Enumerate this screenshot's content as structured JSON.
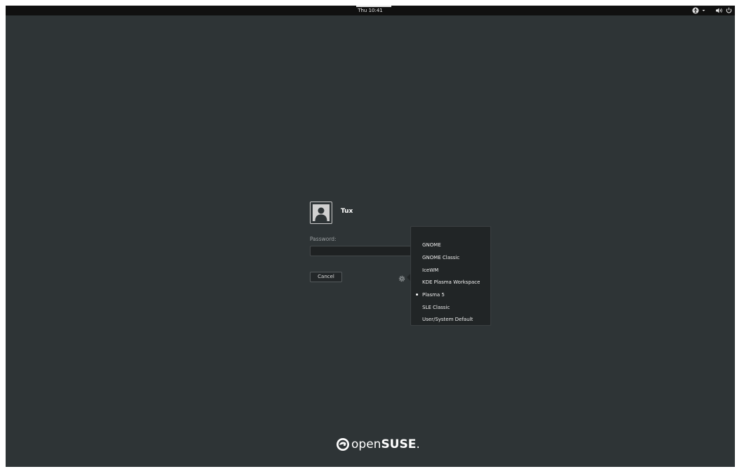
{
  "topbar": {
    "clock": "Thu 10:41"
  },
  "tray": {
    "icons": [
      "accessibility-icon",
      "chevron-down-icon",
      "volume-icon",
      "power-icon"
    ]
  },
  "login": {
    "username": "Tux",
    "password_label": "Password:",
    "password_value": "",
    "cancel_label": "Cancel"
  },
  "session_menu": {
    "items": [
      {
        "label": "GNOME",
        "selected": false
      },
      {
        "label": "GNOME Classic",
        "selected": false
      },
      {
        "label": "IceWM",
        "selected": false
      },
      {
        "label": "KDE Plasma Workspace",
        "selected": false
      },
      {
        "label": "Plasma 5",
        "selected": true
      },
      {
        "label": "SLE Classic",
        "selected": false
      },
      {
        "label": "User/System Default",
        "selected": false
      }
    ]
  },
  "branding": {
    "logo_text_light": "open",
    "logo_text_bold": "SUSE",
    "logo_suffix": "."
  },
  "colors": {
    "background": "#2e3436",
    "topbar": "#101010",
    "menu": "#212526",
    "text": "#ffffff"
  }
}
